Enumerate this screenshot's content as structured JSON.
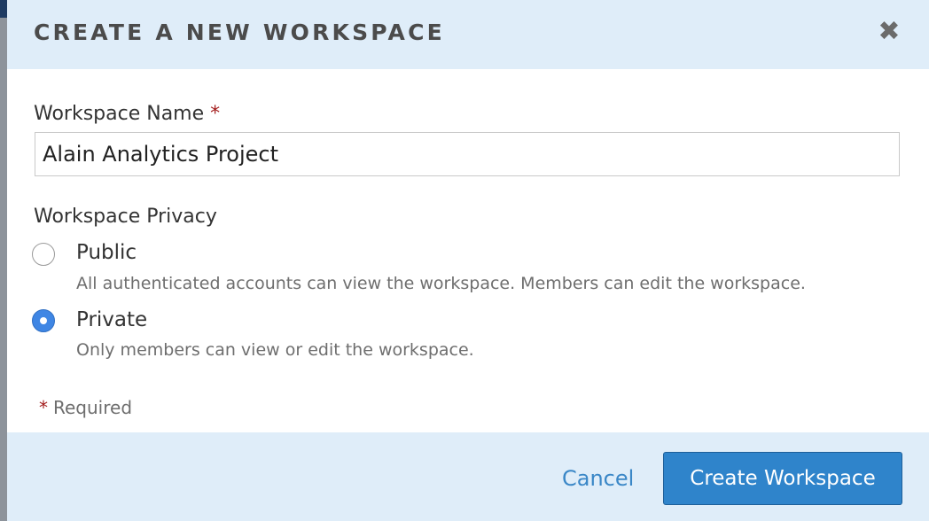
{
  "dialog": {
    "title": "CREATE A NEW WORKSPACE",
    "close_icon": "close-icon",
    "close_glyph": "✖"
  },
  "form": {
    "name_label": "Workspace Name",
    "required_marker": "*",
    "name_value": "Alain Analytics Project",
    "privacy_label": "Workspace Privacy",
    "options": [
      {
        "label": "Public",
        "description": "All authenticated accounts can view the workspace. Members can edit the workspace.",
        "selected": false
      },
      {
        "label": "Private",
        "description": "Only members can view or edit the workspace.",
        "selected": true
      }
    ],
    "required_note": "Required"
  },
  "footer": {
    "cancel_label": "Cancel",
    "create_label": "Create Workspace"
  },
  "colors": {
    "accent": "#2f84cb",
    "header_bg": "#dfedf9",
    "required_star": "#a31c1c",
    "radio_selected": "#3f86e4"
  }
}
